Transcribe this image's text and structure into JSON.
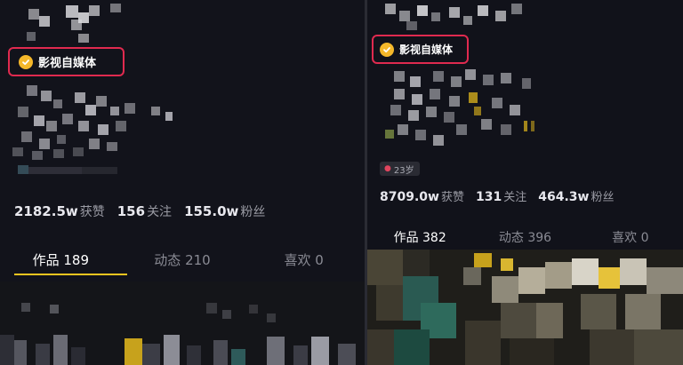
{
  "panels": [
    {
      "badge": {
        "icon": "verified-check-icon",
        "text": "影视自媒体"
      },
      "stats": [
        {
          "value": "2182.5w",
          "label": "获赞"
        },
        {
          "value": "156",
          "label": "关注"
        },
        {
          "value": "155.0w",
          "label": "粉丝"
        }
      ],
      "tabs": [
        {
          "label": "作品 189"
        },
        {
          "label": "动态 210"
        },
        {
          "label": "喜欢 0"
        }
      ]
    },
    {
      "badge": {
        "icon": "verified-check-icon",
        "text": "影视自媒体"
      },
      "age": {
        "icon": "person-icon",
        "text": "23岁"
      },
      "stats": [
        {
          "value": "8709.0w",
          "label": "获赞"
        },
        {
          "value": "131",
          "label": "关注"
        },
        {
          "value": "464.3w",
          "label": "粉丝"
        }
      ],
      "tabs": [
        {
          "label": "作品 382"
        },
        {
          "label": "动态 396"
        },
        {
          "label": "喜欢 0"
        }
      ]
    }
  ],
  "colors": {
    "highlight_border": "#e02a4f",
    "verified_badge": "#f5b82a",
    "active_tab_underline": "#f4c51f"
  }
}
